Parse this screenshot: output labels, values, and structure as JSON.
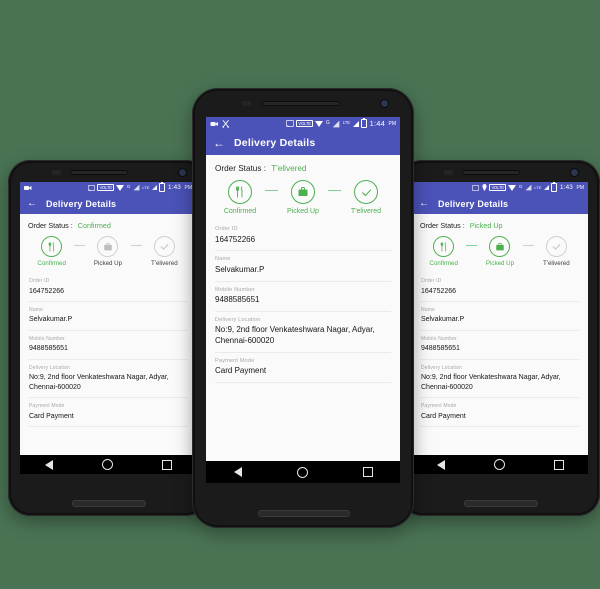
{
  "scene": {
    "background_color": "#4a7354",
    "phone_count": 3
  },
  "theme": {
    "appbar_color": "#4b52b8",
    "accent_green": "#4caf50",
    "inactive_gray": "#cfcfcf",
    "content_bg": "#fafafa"
  },
  "app": {
    "title": "Delivery Details",
    "back_icon": "←",
    "status_label": "Order Status :"
  },
  "steps": {
    "confirmed": {
      "label": "Confirmed",
      "icon": "restaurant-icon"
    },
    "picked_up": {
      "label": "Picked Up",
      "icon": "briefcase-icon"
    },
    "delivered": {
      "label": "T'elivered",
      "icon": "check-icon"
    }
  },
  "order": {
    "rows": [
      {
        "key": "Order ID",
        "value": "164752266"
      },
      {
        "key": "Name",
        "value": "Selvakumar.P"
      },
      {
        "key": "Mobile Number",
        "value": "9488585651"
      },
      {
        "key": "Delivery Location",
        "value": "No:9, 2nd floor Venkateshwara Nagar, Adyar, Chennai-600020"
      },
      {
        "key": "Payment Mode",
        "value": "Card Payment"
      }
    ]
  },
  "phones": {
    "left": {
      "status_value": "Confirmed",
      "time": "1:43",
      "meridiem": "PM",
      "completed": [
        true,
        false,
        false
      ],
      "connectors": [
        false,
        false
      ]
    },
    "center": {
      "status_value": "T'elivered",
      "time": "1:44",
      "meridiem": "PM",
      "completed": [
        true,
        true,
        true
      ],
      "connectors": [
        true,
        true
      ]
    },
    "right": {
      "status_value": "Picked Up",
      "time": "1:43",
      "meridiem": "PM",
      "completed": [
        true,
        true,
        false
      ],
      "connectors": [
        true,
        false
      ]
    }
  },
  "statusbar": {
    "volte_label": "VOLTE",
    "g_label": "G",
    "lte_label": "LTE",
    "cast_icon": "cast-icon",
    "camera_icon": "camera-icon",
    "scissors_icon": "scissors-icon",
    "location_icon": "location-pin-icon",
    "wifi_icon": "wifi-icon",
    "signal_icon": "signal-bars-icon",
    "battery_icon": "battery-icon"
  },
  "navbar": {
    "back": "nav-back-icon",
    "home": "nav-home-icon",
    "recents": "nav-recents-icon"
  }
}
